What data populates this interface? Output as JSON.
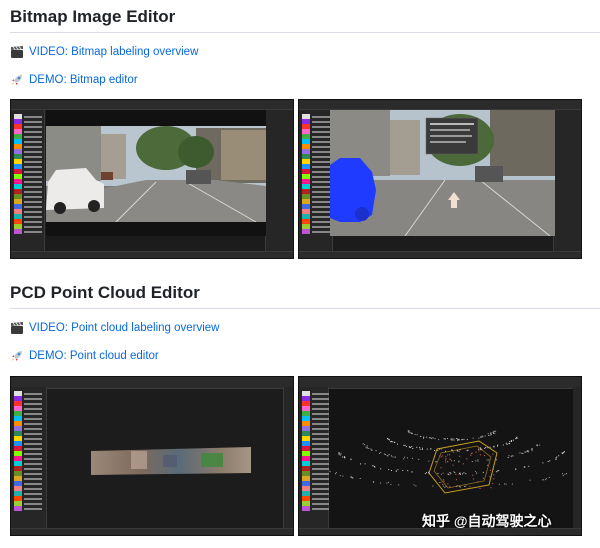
{
  "bitmap_section": {
    "title": "Bitmap Image Editor",
    "video_icon": "film-clapper-icon",
    "video_link": "VIDEO: Bitmap labeling overview",
    "demo_icon": "rocket-icon",
    "demo_link": "DEMO: Bitmap editor"
  },
  "pcd_section": {
    "title": "PCD Point Cloud Editor",
    "video_icon": "film-clapper-icon",
    "video_link": "VIDEO: Point cloud labeling overview",
    "demo_icon": "rocket-icon",
    "demo_link": "DEMO: Point cloud editor"
  },
  "watermark": "知乎 @自动驾驶之心",
  "colors": {
    "link": "#0969da",
    "rule": "#d8dee4",
    "editor_bg": "#1c1c1c",
    "panel_bg": "#262626",
    "car_mask": "#1f3bff",
    "cuboid": "#c8a020"
  },
  "label_swatches": [
    "#e0e0e0",
    "#8a2be2",
    "#ff3030",
    "#ff66cc",
    "#3cb043",
    "#00bfff",
    "#ff8c00",
    "#9370db",
    "#2e8b57",
    "#ffd700",
    "#1e90ff",
    "#dc143c",
    "#7fff00",
    "#ff1493",
    "#00ced1",
    "#b22222",
    "#6b8e23",
    "#daa520",
    "#4169e1",
    "#f08080",
    "#20b2aa",
    "#ff4500",
    "#9acd32",
    "#ba55d3",
    "#cd853f",
    "#00fa9a"
  ]
}
